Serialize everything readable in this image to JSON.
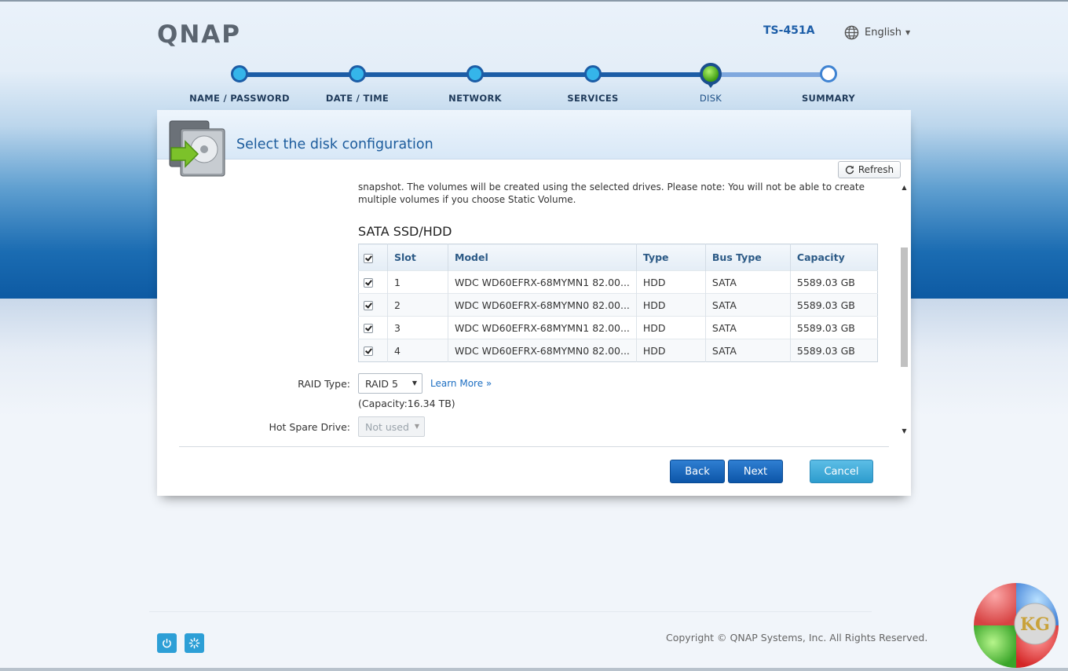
{
  "header": {
    "logo": "QNAP",
    "model": "TS-451A",
    "language": "English"
  },
  "wizard": {
    "steps": [
      {
        "label": "NAME / PASSWORD",
        "state": "done"
      },
      {
        "label": "DATE / TIME",
        "state": "done"
      },
      {
        "label": "NETWORK",
        "state": "done"
      },
      {
        "label": "SERVICES",
        "state": "done"
      },
      {
        "label": "DISK",
        "state": "current"
      },
      {
        "label": "SUMMARY",
        "state": "pending"
      }
    ]
  },
  "dialog": {
    "title": "Select the disk configuration",
    "refresh_label": "Refresh",
    "intro_text": "snapshot. The volumes will be created using the selected drives. Please note: You will not be able to create multiple volumes if you choose Static Volume.",
    "section_title": "SATA SSD/HDD",
    "table": {
      "columns": [
        "Slot",
        "Model",
        "Type",
        "Bus Type",
        "Capacity"
      ],
      "rows": [
        {
          "checked": true,
          "slot": "1",
          "model": "WDC WD60EFRX-68MYMN1 82.00...",
          "type": "HDD",
          "bus": "SATA",
          "capacity": "5589.03 GB"
        },
        {
          "checked": true,
          "slot": "2",
          "model": "WDC WD60EFRX-68MYMN0 82.00...",
          "type": "HDD",
          "bus": "SATA",
          "capacity": "5589.03 GB"
        },
        {
          "checked": true,
          "slot": "3",
          "model": "WDC WD60EFRX-68MYMN1 82.00...",
          "type": "HDD",
          "bus": "SATA",
          "capacity": "5589.03 GB"
        },
        {
          "checked": true,
          "slot": "4",
          "model": "WDC WD60EFRX-68MYMN0 82.00...",
          "type": "HDD",
          "bus": "SATA",
          "capacity": "5589.03 GB"
        }
      ]
    },
    "raid": {
      "label": "RAID Type:",
      "value": "RAID 5",
      "learn_more": "Learn More »",
      "capacity": "(Capacity:16.34 TB)"
    },
    "hot_spare": {
      "label": "Hot Spare Drive:",
      "value": "Not used"
    },
    "buttons": {
      "back": "Back",
      "next": "Next",
      "cancel": "Cancel"
    }
  },
  "footer": {
    "copyright": "Copyright © QNAP Systems, Inc. All Rights Reserved.",
    "power_icon": "power-icon",
    "settings_icon": "spinner-icon"
  },
  "watermark": {
    "text": "KG"
  },
  "colors": {
    "accent_blue": "#1c5da6",
    "step_dot": "#35b5ea",
    "current_step": "#3f9e12",
    "cancel_button": "#2d9ccd"
  }
}
